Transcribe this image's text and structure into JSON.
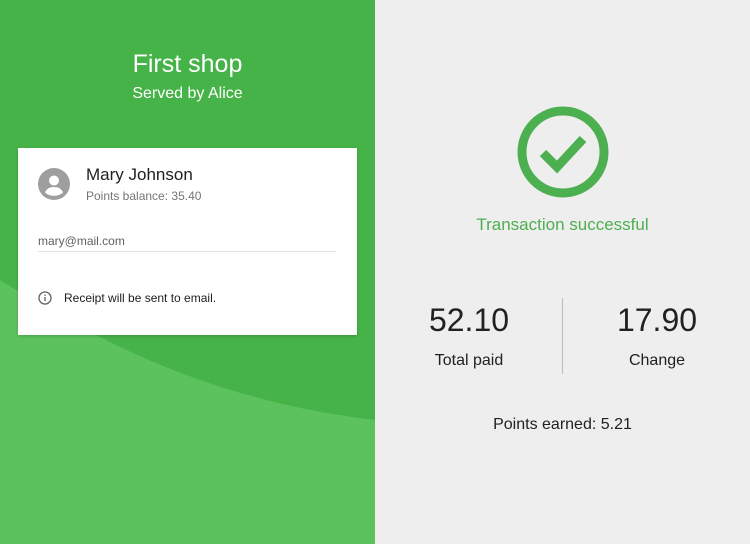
{
  "shop": {
    "title": "First shop",
    "served_by": "Served by Alice"
  },
  "customer": {
    "name": "Mary Johnson",
    "points_balance": "Points balance: 35.40",
    "email_value": "mary@mail.com",
    "receipt_note": "Receipt will be sent to email.",
    "avatar_icon": "account-circle-icon",
    "info_icon": "info-icon"
  },
  "transaction": {
    "status_text": "Transaction successful",
    "status_icon": "check-circle-icon",
    "total_paid_value": "52.10",
    "total_paid_label": "Total paid",
    "change_value": "17.90",
    "change_label": "Change",
    "points_earned": "Points earned: 5.21"
  },
  "colors": {
    "primary_green": "#46b348",
    "light_green_wave": "#5cc25e",
    "success_green": "#4caf50",
    "right_background": "#eeeeee",
    "avatar_gray": "#9e9e9e"
  }
}
